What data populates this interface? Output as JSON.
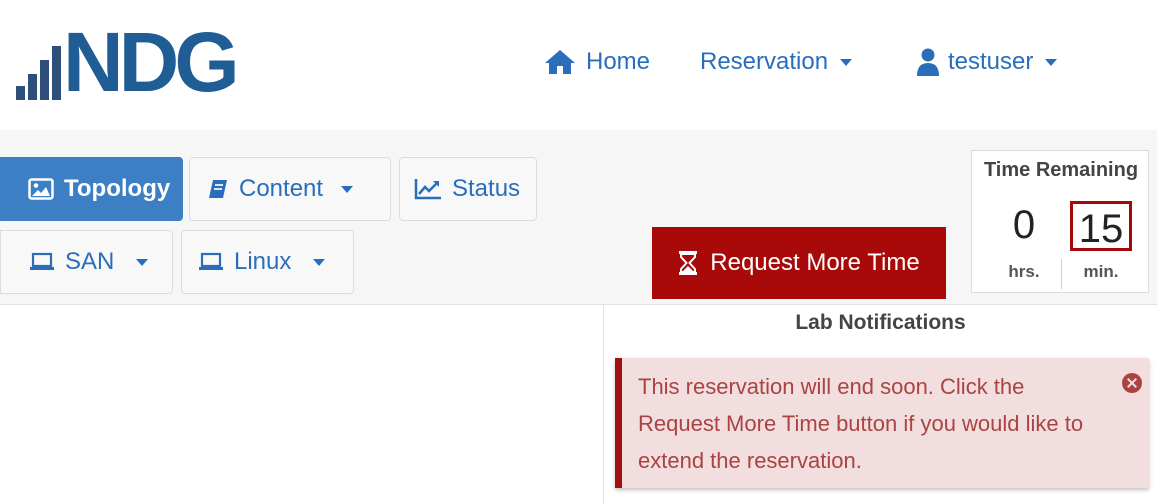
{
  "brand": {
    "logo_text": "NDG"
  },
  "nav": {
    "home_label": "Home",
    "reservation_label": "Reservation",
    "user_label": "testuser"
  },
  "tabs": [
    {
      "label": "Topology",
      "icon": "image-icon",
      "active": true
    },
    {
      "label": "Content",
      "icon": "book-icon",
      "dropdown": true
    },
    {
      "label": "Status",
      "icon": "chart-line-icon"
    },
    {
      "label": "SAN",
      "icon": "laptop-icon",
      "dropdown": true
    },
    {
      "label": "Linux",
      "icon": "laptop-icon",
      "dropdown": true
    }
  ],
  "request_button": {
    "label": "Request More Time",
    "icon": "hourglass-icon"
  },
  "timer": {
    "title": "Time Remaining",
    "hours": "0",
    "minutes": "15",
    "hours_label": "hrs.",
    "minutes_label": "min."
  },
  "notifications": {
    "title": "Lab Notifications",
    "message": "This reservation will end soon. Click the Request More Time button if you would like to extend the reservation."
  },
  "colors": {
    "primary": "#2a6ebb",
    "active_tab": "#3c7fc4",
    "danger": "#a80a0a",
    "alert_bg": "#f2dede",
    "alert_text": "#a94442"
  }
}
